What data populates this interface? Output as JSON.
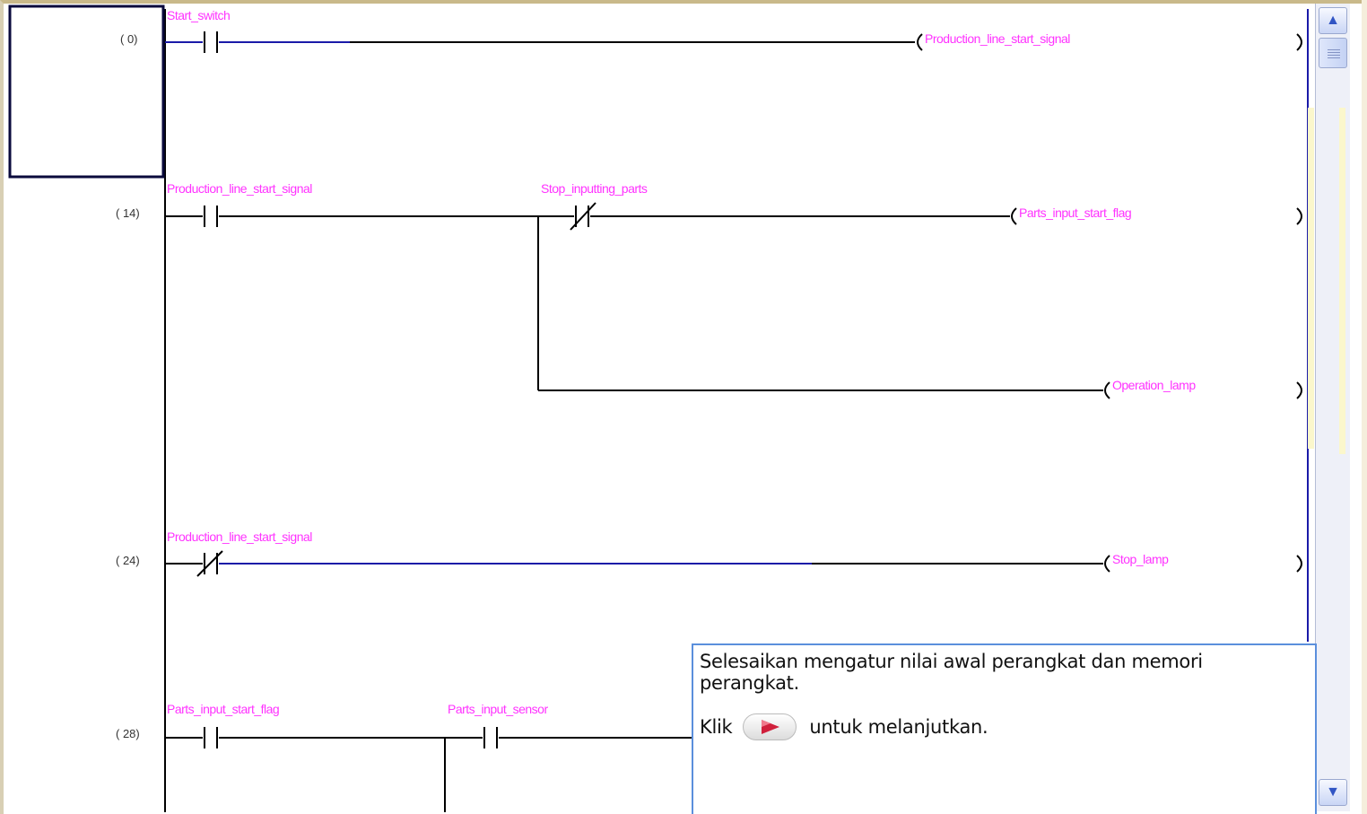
{
  "ladder": {
    "rungs": [
      {
        "step": "(    0)",
        "contacts": [
          {
            "label": "Start_switch"
          }
        ],
        "coils": [
          {
            "label": "Production_line_start_signal"
          }
        ]
      },
      {
        "step": "(   14)",
        "contacts": [
          {
            "label": "Production_line_start_signal"
          },
          {
            "label": "Stop_inputting_parts"
          }
        ],
        "coils": [
          {
            "label": "Parts_input_start_flag"
          },
          {
            "label": "Operation_lamp"
          }
        ]
      },
      {
        "step": "(   24)",
        "contacts": [
          {
            "label": "Production_line_start_signal"
          }
        ],
        "coils": [
          {
            "label": "Stop_lamp"
          }
        ]
      },
      {
        "step": "(   28)",
        "contacts": [
          {
            "label": "Parts_input_start_flag"
          },
          {
            "label": "Parts_input_sensor"
          }
        ],
        "coils": []
      }
    ]
  },
  "tooltip": {
    "message": "Selesaikan mengatur nilai awal perangkat dan memori perangkat.",
    "click_prefix": "Klik",
    "click_suffix": "untuk melanjutkan."
  },
  "icons": {
    "scroll_up": "scroll-up-arrow",
    "scroll_down": "scroll-down-arrow",
    "next": "next-play-icon"
  },
  "colors": {
    "device_label": "#ff33ff",
    "wire": "#000000",
    "active_wire": "#1a1aa8",
    "cursor": "#0a0a3c",
    "tooltip_border": "#5b8fdc",
    "next_arrow": "#d0203c"
  }
}
